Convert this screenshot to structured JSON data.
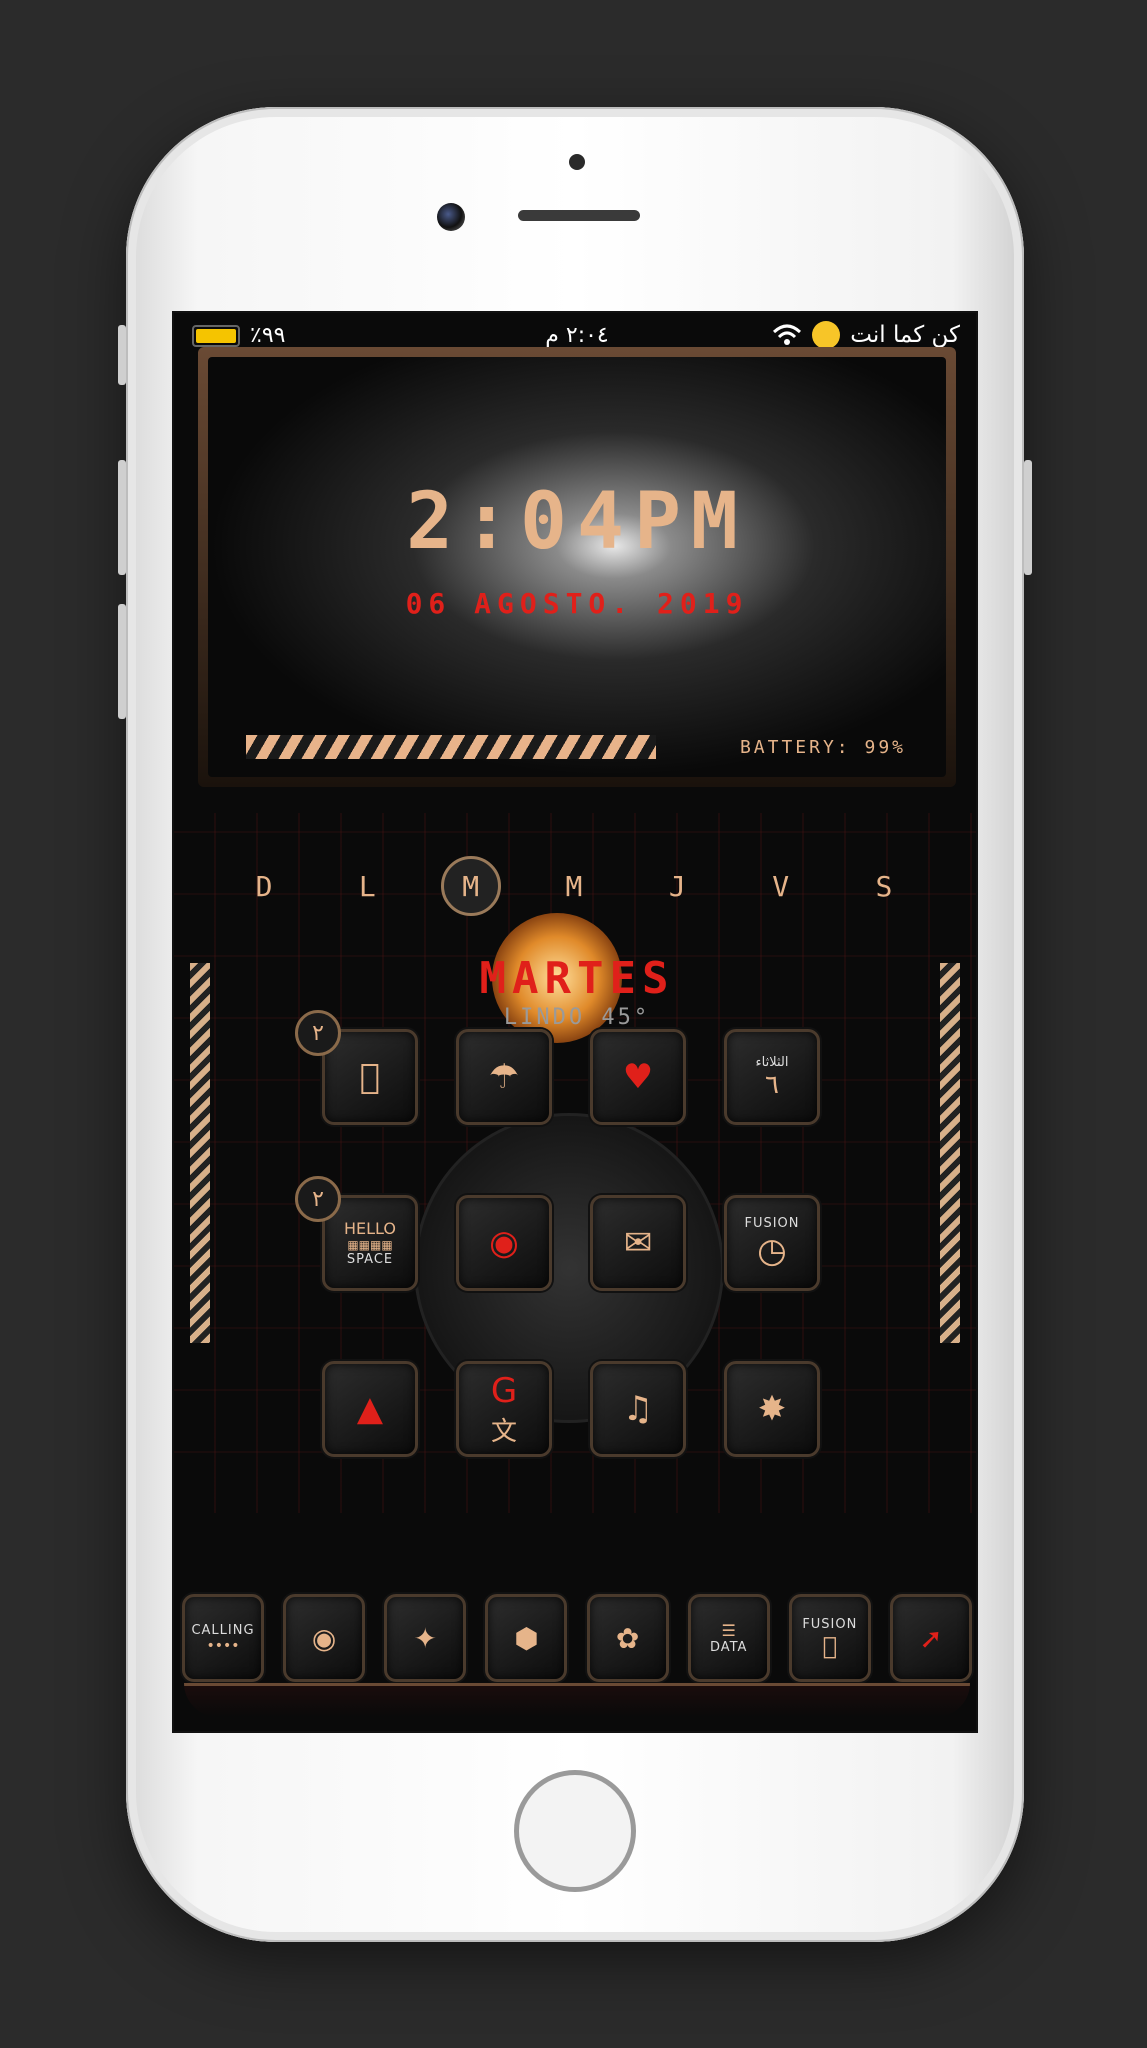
{
  "status_bar": {
    "battery_percent": "٪٩٩",
    "battery_level": 0.99,
    "time": "٢:٠٤ م",
    "carrier": "كن كما انت"
  },
  "clock_widget": {
    "time": "2:04PM",
    "date": "06 AGOSTO. 2019",
    "battery": "BATTERY: 99%"
  },
  "weekdays": {
    "items": [
      "D",
      "L",
      "M",
      "M",
      "J",
      "V",
      "S"
    ],
    "active_index": 2
  },
  "weather": {
    "day": "MARTES",
    "conditions": "LINDO 45°"
  },
  "home_icons": {
    "badge_row1": "٢",
    "badge_row2": "٢",
    "calendar_day": "الثلاثاء",
    "calendar_date": "٦",
    "keyboard_text": "HELLO",
    "keyboard_space": "SPACE",
    "clock_brand": "FUSION"
  },
  "dock": {
    "calling_label": "CALLING",
    "data_label": "DATA",
    "fusion_label": "FUSION"
  }
}
